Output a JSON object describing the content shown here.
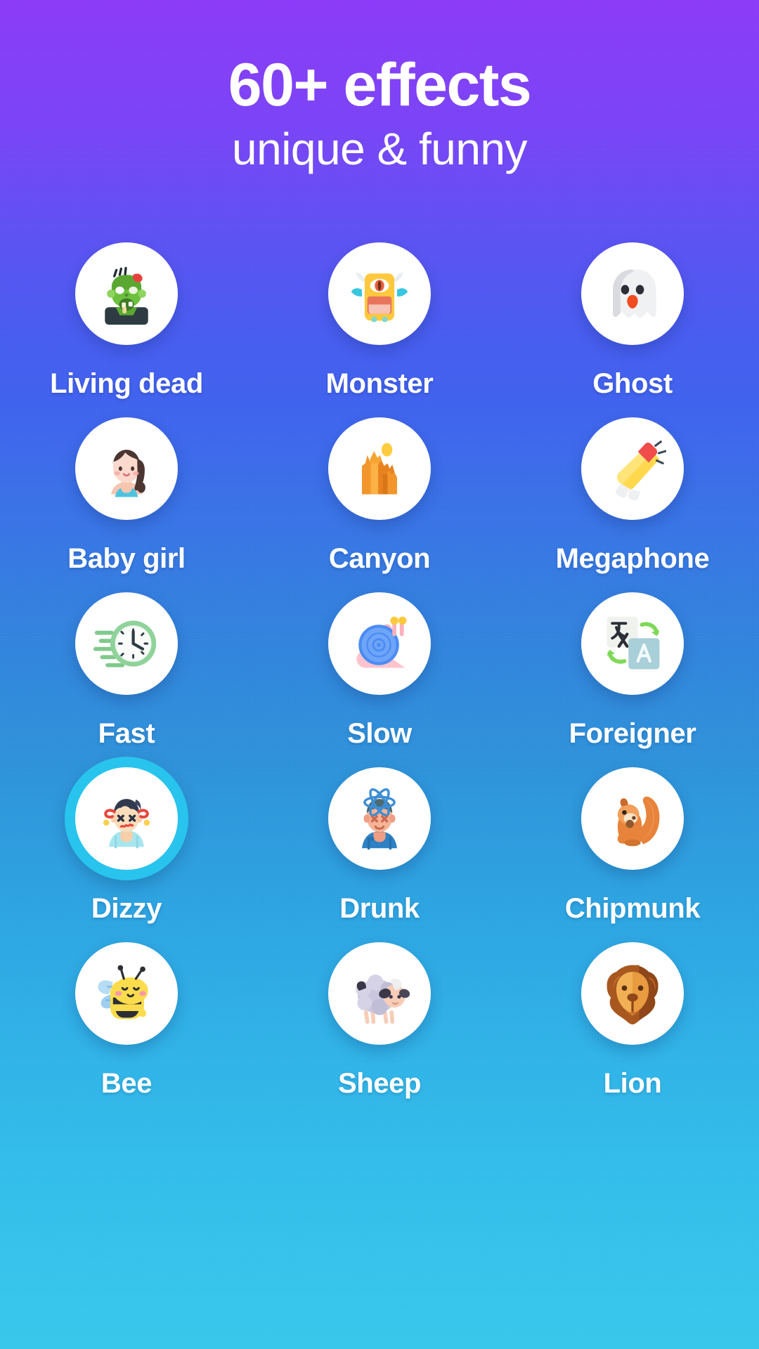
{
  "header": {
    "title": "60+ effects",
    "subtitle": "unique & funny"
  },
  "colors": {
    "gradient_top": "#8b3cf7",
    "gradient_mid": "#4a5cf0",
    "gradient_bottom": "#39c8ec",
    "selection_ring": "#29c4ee",
    "circle_background": "#ffffff",
    "label_text": "#ffffff"
  },
  "effects": [
    {
      "label": "Living dead",
      "icon": "zombie-icon",
      "selected": false
    },
    {
      "label": "Monster",
      "icon": "monster-icon",
      "selected": false
    },
    {
      "label": "Ghost",
      "icon": "ghost-icon",
      "selected": false
    },
    {
      "label": "Baby girl",
      "icon": "baby-girl-icon",
      "selected": false
    },
    {
      "label": "Canyon",
      "icon": "canyon-icon",
      "selected": false
    },
    {
      "label": "Megaphone",
      "icon": "megaphone-icon",
      "selected": false
    },
    {
      "label": "Fast",
      "icon": "fast-clock-icon",
      "selected": false
    },
    {
      "label": "Slow",
      "icon": "snail-icon",
      "selected": false
    },
    {
      "label": "Foreigner",
      "icon": "translate-icon",
      "selected": false
    },
    {
      "label": "Dizzy",
      "icon": "dizzy-face-icon",
      "selected": true
    },
    {
      "label": "Drunk",
      "icon": "drunk-face-icon",
      "selected": false
    },
    {
      "label": "Chipmunk",
      "icon": "squirrel-icon",
      "selected": false
    },
    {
      "label": "Bee",
      "icon": "bee-icon",
      "selected": false
    },
    {
      "label": "Sheep",
      "icon": "sheep-icon",
      "selected": false
    },
    {
      "label": "Lion",
      "icon": "lion-icon",
      "selected": false
    }
  ]
}
